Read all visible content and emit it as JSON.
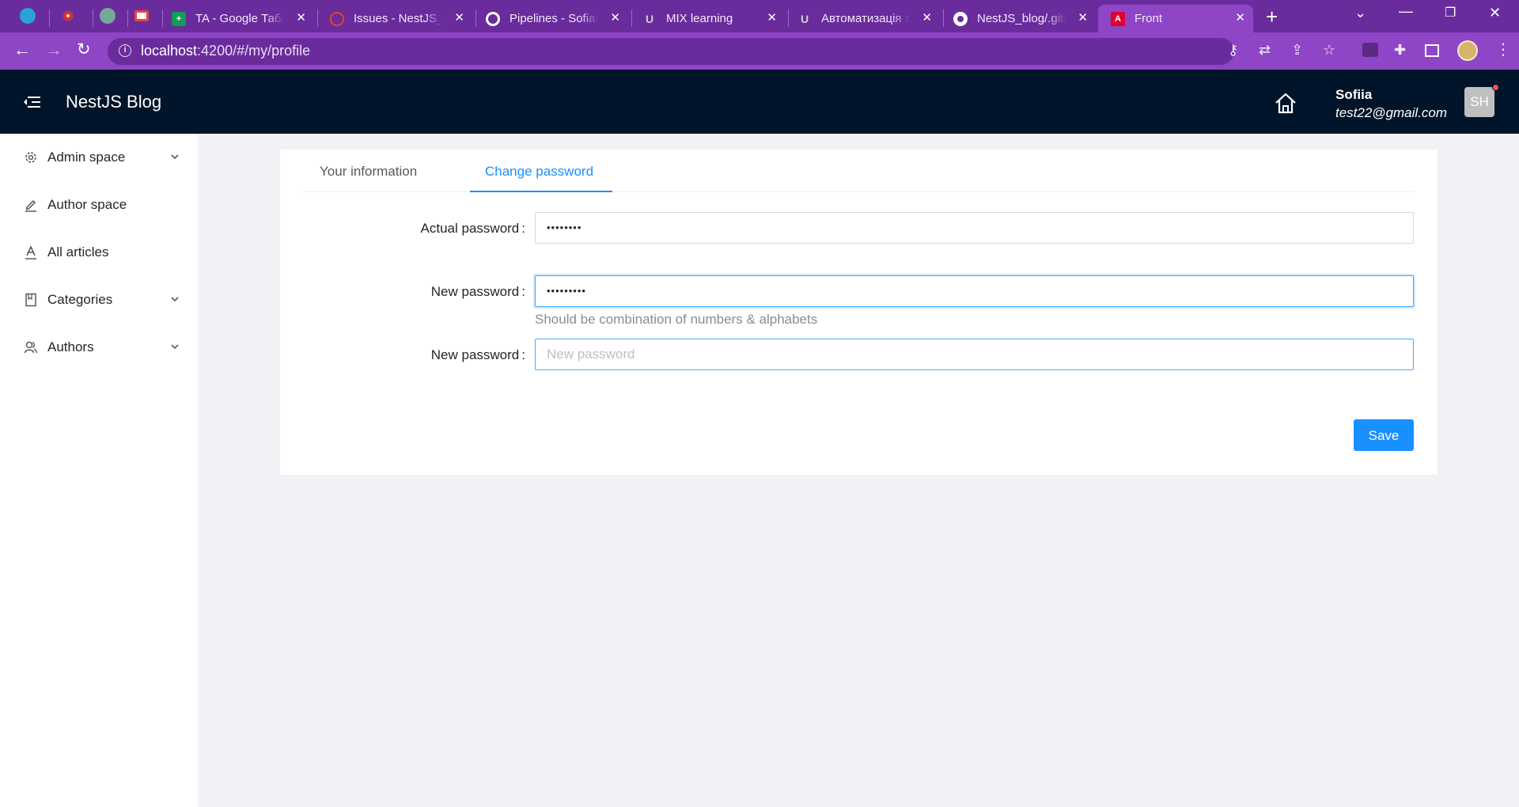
{
  "browser": {
    "tabs": [
      {
        "title": "TA - Google Табли",
        "icon": "sheets-icon",
        "color": "#0f9d58"
      },
      {
        "title": "Issues - NestJS_bl",
        "icon": "cloud-icon",
        "color": "#e24329"
      },
      {
        "title": "Pipelines - SofiaG",
        "icon": "pipeline-icon",
        "color": "#ffffff"
      },
      {
        "title": "MIX learning",
        "icon": "mix-icon",
        "color": "#cccccc"
      },
      {
        "title": "Автоматизація те",
        "icon": "mix-icon",
        "color": "#cccccc"
      },
      {
        "title": "NestJS_blog/.githu",
        "icon": "github-icon",
        "color": "#ffffff"
      },
      {
        "title": "Front",
        "icon": "angular-icon",
        "color": "#dd0031"
      }
    ],
    "url_host": "localhost",
    "url_path": ":4200/#/my/profile"
  },
  "header": {
    "brand": "NestJS Blog",
    "user_name": "Sofiia",
    "user_email": "test22@gmail.com",
    "avatar_initials": "SH"
  },
  "sidebar": {
    "items": [
      {
        "label": "Admin space",
        "icon": "gear-icon",
        "expandable": true
      },
      {
        "label": "Author space",
        "icon": "edit-icon",
        "expandable": false
      },
      {
        "label": "All articles",
        "icon": "font-icon",
        "expandable": false
      },
      {
        "label": "Categories",
        "icon": "book-icon",
        "expandable": true
      },
      {
        "label": "Authors",
        "icon": "team-icon",
        "expandable": true
      }
    ]
  },
  "profile": {
    "tabs": [
      {
        "label": "Your information",
        "active": false
      },
      {
        "label": "Change password",
        "active": true
      }
    ],
    "form": {
      "actual_label": "Actual password",
      "actual_value": "••••••••",
      "new_label": "New password",
      "new_value": "•••••••••",
      "new_help": "Should be combination of numbers & alphabets",
      "confirm_label": "New password",
      "confirm_placeholder": "New password",
      "colon": ":"
    },
    "save_label": "Save"
  },
  "colors": {
    "chrome": "#8e45c6",
    "header": "#001529",
    "primary": "#1890ff"
  }
}
